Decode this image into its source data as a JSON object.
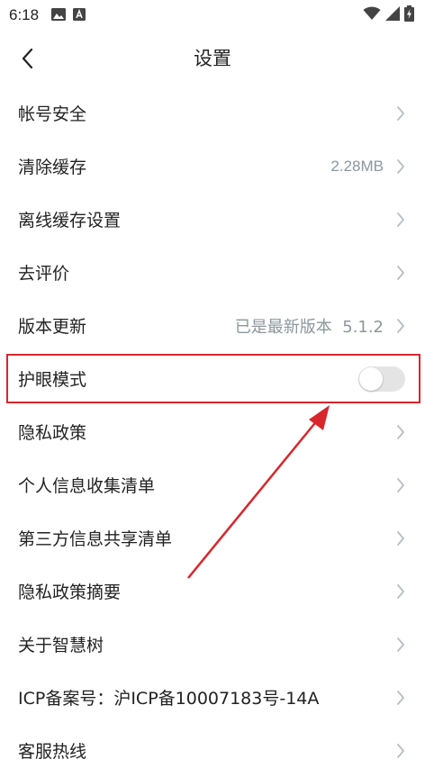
{
  "status_bar": {
    "time": "6:18"
  },
  "header": {
    "title": "设置"
  },
  "settings": {
    "items": [
      {
        "label": "帐号安全",
        "value": ""
      },
      {
        "label": "清除缓存",
        "value": "2.28MB"
      },
      {
        "label": "离线缓存设置",
        "value": ""
      },
      {
        "label": "去评价",
        "value": ""
      },
      {
        "label": "版本更新",
        "value": "已是最新版本  5.1.2"
      },
      {
        "label": "护眼模式",
        "toggle_on": false
      },
      {
        "label": "隐私政策",
        "value": ""
      },
      {
        "label": "个人信息收集清单",
        "value": ""
      },
      {
        "label": "第三方信息共享清单",
        "value": ""
      },
      {
        "label": "隐私政策摘要",
        "value": ""
      },
      {
        "label": "关于智慧树",
        "value": ""
      },
      {
        "label": "ICP备案号：沪ICP备10007183号-14A",
        "value": ""
      },
      {
        "label": "客服热线",
        "value": ""
      }
    ]
  },
  "colors": {
    "highlight": "#d9262c",
    "value_text": "#8b979d",
    "chevron": "#b8bec2"
  }
}
